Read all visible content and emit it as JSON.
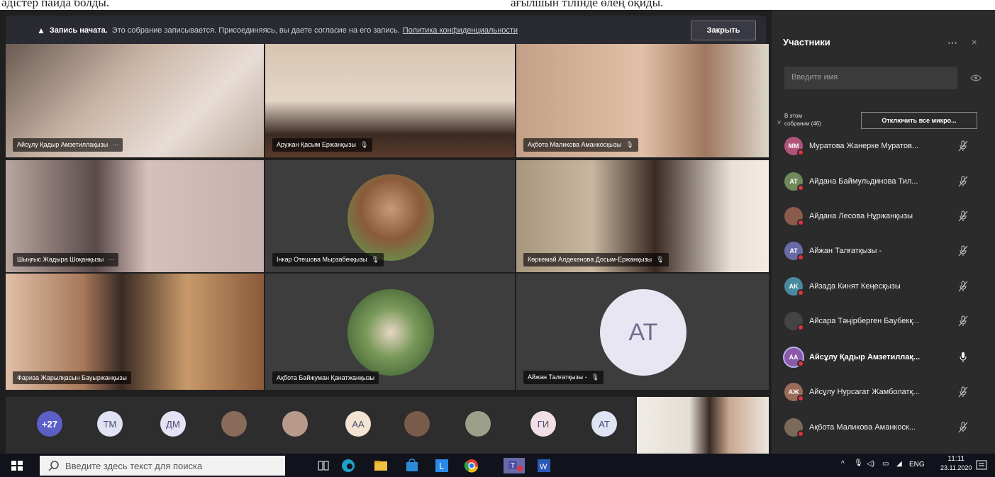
{
  "document": {
    "line_left": "әдістер пайда болды.",
    "line_right": "ағылшын тілінде өлең оқиды."
  },
  "banner": {
    "bold": "Запись начата.",
    "text": "Это собрание записывается. Присоединяясь, вы даете согласие на его запись.",
    "link": "Политика конфиденциальности",
    "close": "Закрыть"
  },
  "grid": [
    {
      "name": "Айсұлу Қадыр Амзетиллақызы",
      "extra": "⋯"
    },
    {
      "name": "Аружан Қасым Ержанқызы",
      "extra": "🎙"
    },
    {
      "name": "Ақбота Маликова Аманкосқызы",
      "extra": "🎙"
    },
    {
      "name": "Шыңғыс Жадыра Шоқанқызы",
      "extra": "⋯"
    },
    {
      "name": "Інкар Отешова Мырзабекқызы",
      "extra": "🎙"
    },
    {
      "name": "Көркемай Алдекенова Досым-Ержанқызы",
      "extra": "🎙"
    },
    {
      "name": "Фариза Жарылқасын Бауыржанқызы",
      "extra": ""
    },
    {
      "name": "Ақбота Байжуман Қанатжанқызы",
      "extra": ""
    },
    {
      "name": "Айжан Талғатқызы -",
      "extra": "🎙",
      "initials": "AT"
    }
  ],
  "strip": [
    {
      "label": "+27",
      "color": "#5b5fc7",
      "text_color": "#ffffff"
    },
    {
      "label": "TM",
      "color": "#dfe3f3"
    },
    {
      "label": "ДМ",
      "color": "#e6e1f3"
    },
    {
      "label": "",
      "color": "#8a6a5a"
    },
    {
      "label": "",
      "color": "#b89a8a"
    },
    {
      "label": "AA",
      "color": "#f3e3d3"
    },
    {
      "label": "",
      "color": "#7a5a4a"
    },
    {
      "label": "",
      "color": "#9aa08a"
    },
    {
      "label": "ГИ",
      "color": "#f0e0e6"
    },
    {
      "label": "AT",
      "color": "#dfe3f3"
    }
  ],
  "panel": {
    "title": "Участники",
    "more": "⋯",
    "close": "×",
    "search_placeholder": "Введите имя",
    "section": "В этом собрании (46)",
    "mute_all": "Отключить все микро...",
    "participants": [
      {
        "initials": "MM",
        "name": "Муратова Жанерке Муратов...",
        "color": "#b0537a",
        "muted": true
      },
      {
        "initials": "AT",
        "name": "Айдана Баймульдинова Тил...",
        "color": "#6e8a5a",
        "muted": true
      },
      {
        "initials": "",
        "name": "Айдана Лесова Нұржанқызы",
        "color": "#8a5a4a",
        "muted": true
      },
      {
        "initials": "AT",
        "name": "Айжан Талғатқызы -",
        "color": "#6a6aa8",
        "muted": true
      },
      {
        "initials": "AK",
        "name": "Айзада Кинят Кеңесқызы",
        "color": "#4a8aa0",
        "muted": true
      },
      {
        "initials": "",
        "name": "Айсара Тәңірберген Баубекқ...",
        "color": "#444444",
        "muted": true
      },
      {
        "initials": "AA",
        "name": "Айсұлу Қадыр Амзетиллақ...",
        "color": "#8a5aa8",
        "muted": false,
        "bold": true
      },
      {
        "initials": "AЖ",
        "name": "Айсұлу Нурсагат Жамболатқ...",
        "color": "#9a6a5a",
        "muted": true
      },
      {
        "initials": "",
        "name": "Ақбота Маликова Аманкоск...",
        "color": "#7a6a5a",
        "muted": true
      }
    ]
  },
  "taskbar": {
    "search": "Введите здесь текст для поиска",
    "lang": "ENG",
    "time": "11:11",
    "date": "23.11.2020"
  },
  "colors": {
    "app_bg": "#1f1f1f",
    "panel_bg": "#2b2b2b",
    "accent": "#5b5fc7",
    "presence_red": "#e1323e"
  }
}
